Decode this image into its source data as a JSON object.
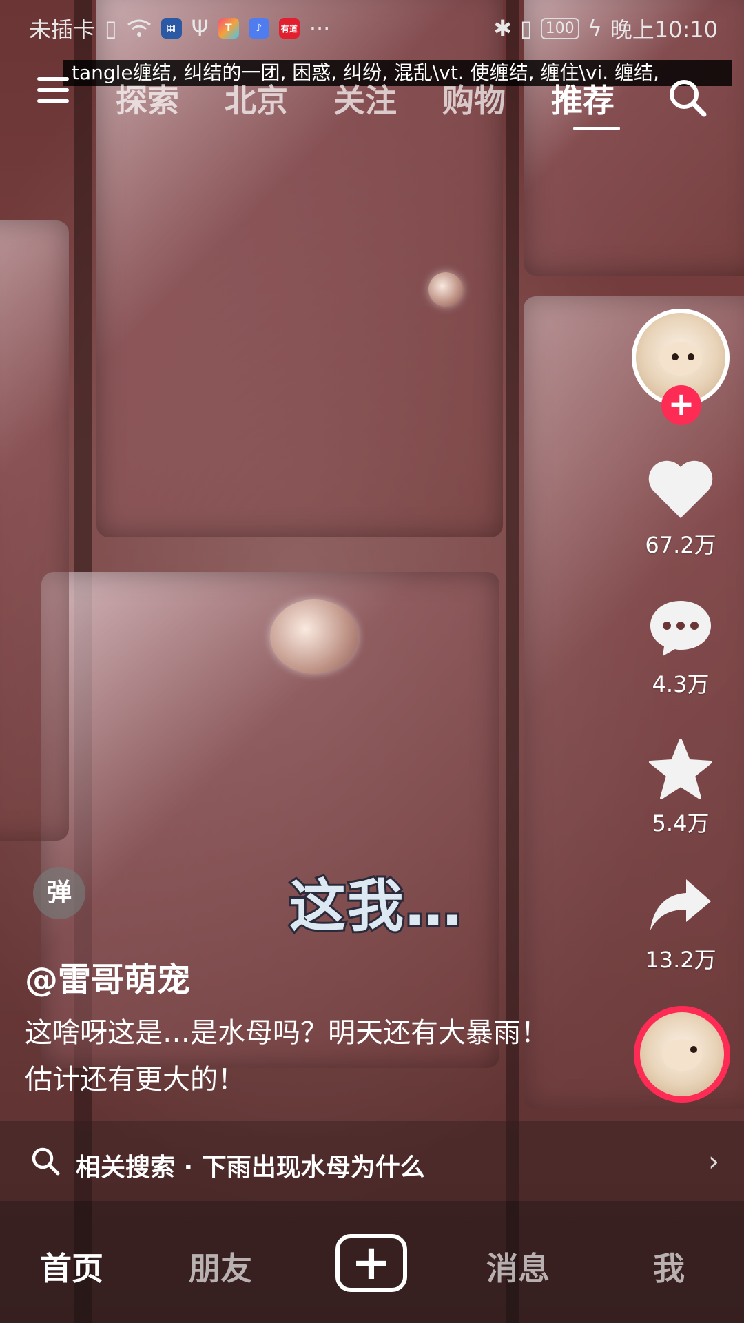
{
  "status_bar": {
    "carrier": "未插卡",
    "app_icons": [
      {
        "name": "game-app-icon",
        "color": "#2b59a3"
      },
      {
        "name": "theme-app-icon",
        "color": "#f3a23c"
      },
      {
        "name": "music-app-icon",
        "color": "#4f7df0"
      },
      {
        "name": "youdao-app-icon",
        "label": "有道",
        "color": "#e11f2f"
      }
    ],
    "more": "···",
    "battery": "100",
    "time": "晚上10:10"
  },
  "translation": "tangle缠结, 纠结的一团, 困惑, 纠纷, 混乱\\vt. 使缠结, 缠住\\vi. 缠结,",
  "top_nav": {
    "tabs": [
      "探索",
      "北京",
      "关注",
      "购物",
      "推荐"
    ],
    "active_tab": "推荐"
  },
  "actions": {
    "like_count": "67.2万",
    "comment_count": "4.3万",
    "favorite_count": "5.4万",
    "share_count": "13.2万",
    "follow_symbol": "+"
  },
  "video": {
    "subtitle": "这我…",
    "danmu_label": "弹",
    "author": "@雷哥萌宠",
    "description": "这啥呀这是…是水母吗？明天还有大暴雨！估计还有更大的！"
  },
  "related_search": {
    "text": "相关搜索 · 下雨出现水母为什么"
  },
  "bottom_nav": {
    "home": "首页",
    "friends": "朋友",
    "create_symbol": "+",
    "messages": "消息",
    "me": "我"
  },
  "colors": {
    "accent": "#fe2c55",
    "video_tint": "#6b3535"
  }
}
